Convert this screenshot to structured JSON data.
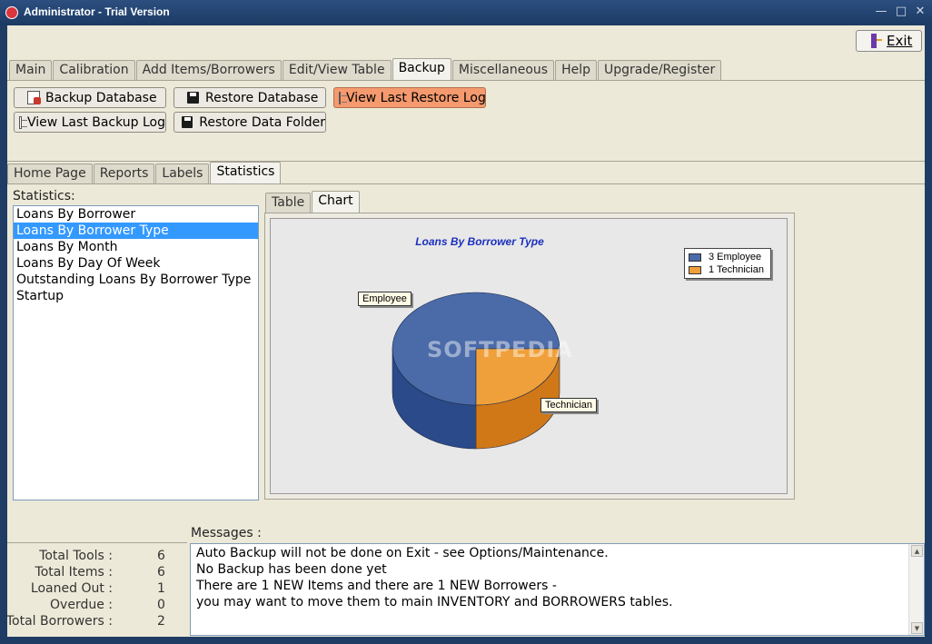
{
  "window": {
    "title": "Administrator - Trial Version"
  },
  "toolbar": {
    "exit_label": "Exit"
  },
  "main_tabs": [
    "Main",
    "Calibration",
    "Add Items/Borrowers",
    "Edit/View Table",
    "Backup",
    "Miscellaneous",
    "Help",
    "Upgrade/Register"
  ],
  "backup": {
    "backup_database": "Backup Database",
    "restore_database": "Restore Database",
    "view_last_restore_log": "View Last Restore Log",
    "view_last_backup_log": "View Last Backup Log",
    "restore_data_folder": "Restore Data Folder"
  },
  "sub_tabs": [
    "Home Page",
    "Reports",
    "Labels",
    "Statistics"
  ],
  "statistics": {
    "label": "Statistics:",
    "items": [
      "Loans By Borrower",
      "Loans By Borrower Type",
      "Loans By Month",
      "Loans By Day Of Week",
      "Outstanding Loans By Borrower Type",
      "Startup"
    ],
    "selected": "Loans By Borrower Type"
  },
  "chart_tabs": [
    "Table",
    "Chart"
  ],
  "chart_data": {
    "type": "pie",
    "title": "Loans By Borrower Type",
    "categories": [
      "Employee",
      "Technician"
    ],
    "values": [
      3,
      1
    ],
    "legend": [
      "3 Employee",
      "1 Technician"
    ],
    "colors": [
      "#4a6aa8",
      "#f0a03a"
    ],
    "legend_position": "top-right"
  },
  "watermark": "SOFTPEDIA",
  "messages": {
    "label": "Messages :",
    "lines": [
      "Auto Backup will not be done on Exit - see Options/Maintenance.",
      "No Backup has been done yet",
      "There are 1 NEW Items and there are 1 NEW Borrowers -",
      "you may want to move them to main INVENTORY and BORROWERS tables."
    ]
  },
  "summary": [
    {
      "label": "Total Tools :",
      "value": "6"
    },
    {
      "label": "Total Items :",
      "value": "6"
    },
    {
      "label": "Loaned Out :",
      "value": "1"
    },
    {
      "label": "Overdue :",
      "value": "0"
    },
    {
      "label": "Total Borrowers :",
      "value": "2"
    }
  ]
}
